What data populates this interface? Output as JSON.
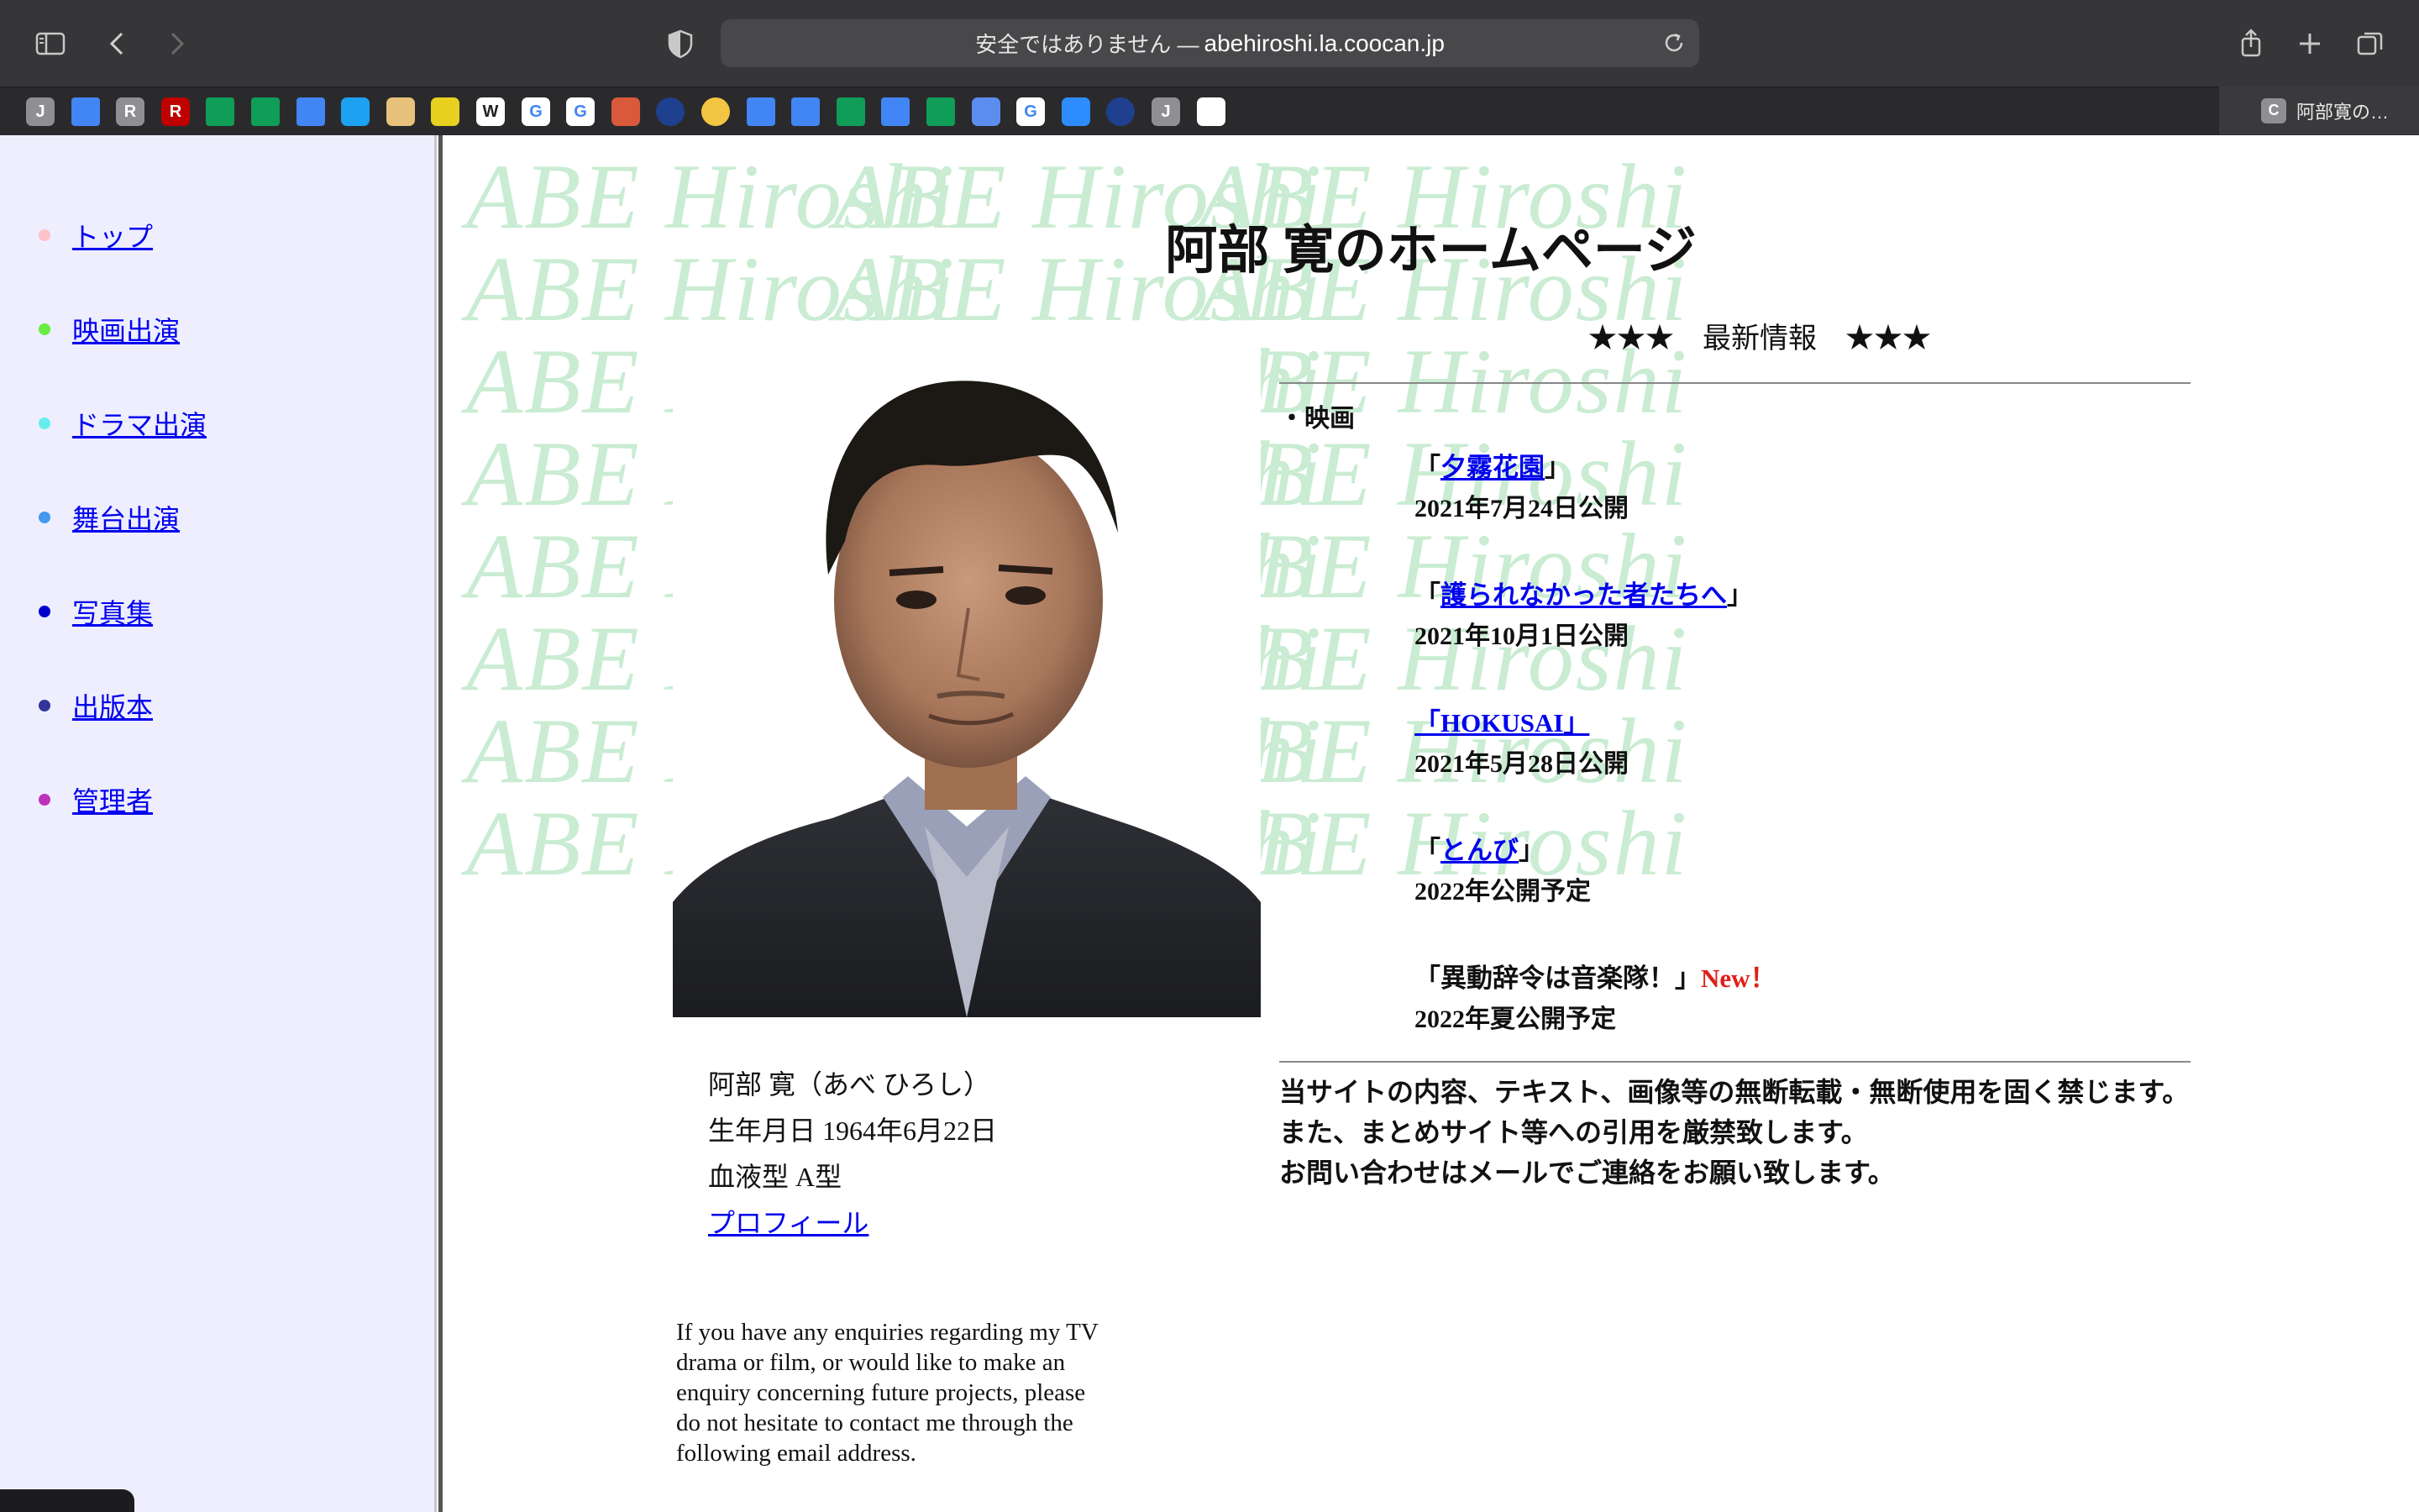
{
  "browser": {
    "address_prefix": "安全ではありません — ",
    "address_domain": "abehiroshi.la.coocan.jp",
    "favicons": [
      {
        "name": "j-icon",
        "label": "J",
        "color": "#8e8e93"
      },
      {
        "name": "google-docs-icon",
        "label": "",
        "color": "#4285f4"
      },
      {
        "name": "r-icon",
        "label": "R",
        "color": "#8e8e93"
      },
      {
        "name": "rakuten-icon",
        "label": "R",
        "color": "#bf0000"
      },
      {
        "name": "google-sheets-icon",
        "label": "",
        "color": "#0f9d58"
      },
      {
        "name": "google-sheets-icon",
        "label": "",
        "color": "#0f9d58"
      },
      {
        "name": "google-docs-icon",
        "label": "",
        "color": "#4285f4"
      },
      {
        "name": "twitter-icon",
        "label": "",
        "color": "#1da1f2"
      },
      {
        "name": "package-icon",
        "label": "",
        "color": "#e8c27a"
      },
      {
        "name": "note-icon",
        "label": "",
        "color": "#e8d020"
      },
      {
        "name": "wikipedia-icon",
        "label": "W",
        "color": "#ffffff"
      },
      {
        "name": "google-icon",
        "label": "G",
        "color": "#ffffff"
      },
      {
        "name": "google-icon",
        "label": "G",
        "color": "#ffffff"
      },
      {
        "name": "app-icon",
        "label": "",
        "color": "#d85a3a"
      },
      {
        "name": "globe-icon",
        "label": "",
        "color": "#1f3f8f"
      },
      {
        "name": "circle-icon",
        "label": "",
        "color": "#f4c542"
      },
      {
        "name": "google-docs-icon",
        "label": "",
        "color": "#4285f4"
      },
      {
        "name": "google-docs-icon",
        "label": "",
        "color": "#4285f4"
      },
      {
        "name": "google-sheets-icon",
        "label": "",
        "color": "#0f9d58"
      },
      {
        "name": "google-docs-icon",
        "label": "",
        "color": "#4285f4"
      },
      {
        "name": "google-sheets-icon",
        "label": "",
        "color": "#0f9d58"
      },
      {
        "name": "calendar-icon",
        "label": "",
        "color": "#5b8def"
      },
      {
        "name": "google-icon",
        "label": "G",
        "color": "#ffffff"
      },
      {
        "name": "zoom-icon",
        "label": "",
        "color": "#2d8cff"
      },
      {
        "name": "globe-icon",
        "label": "",
        "color": "#1f3f8f"
      },
      {
        "name": "j-icon",
        "label": "J",
        "color": "#8e8e93"
      },
      {
        "name": "github-icon",
        "label": "",
        "color": "#ffffff"
      }
    ],
    "active_tab": {
      "icon": "C",
      "title": "阿部寛の…"
    }
  },
  "sidebar": {
    "items": [
      {
        "label": "トップ",
        "dot": "#ffc0c8"
      },
      {
        "label": "映画出演",
        "dot": "#66ee44"
      },
      {
        "label": "ドラマ出演",
        "dot": "#66eeee"
      },
      {
        "label": "舞台出演",
        "dot": "#4499ee"
      },
      {
        "label": "写真集",
        "dot": "#0000cc"
      },
      {
        "label": "出版本",
        "dot": "#333399"
      },
      {
        "label": "管理者",
        "dot": "#bb33bb"
      }
    ]
  },
  "main": {
    "watermark": "ABE Hiroshi",
    "title": "阿部 寛のホームページ",
    "profile": {
      "name": "阿部 寛（あべ ひろし）",
      "birth": "生年月日 1964年6月22日",
      "blood": "血液型 A型",
      "profile_link": "プロフィール"
    },
    "enquiry": "If you have any enquiries regarding my TV drama or film, or would like to make an enquiry concerning future projects, please do not hesitate to contact me through the following email address.",
    "news": {
      "heading": "★★★　最新情報　★★★",
      "category": "・映画",
      "films": [
        {
          "title": "夕霧花園",
          "date": "2021年7月24日公開",
          "link": true,
          "new": ""
        },
        {
          "title": "護られなかった者たちへ",
          "date": "2021年10月1日公開",
          "link": true,
          "new": ""
        },
        {
          "title": "HOKUSAI",
          "date": "2021年5月28日公開",
          "link": true,
          "new": ""
        },
        {
          "title": "とんび",
          "date": "2022年公開予定",
          "link": true,
          "new": ""
        },
        {
          "title": "異動辞令は音楽隊！",
          "date": "2022年夏公開予定",
          "link": false,
          "new": "New！"
        }
      ],
      "open_bracket": "「",
      "close_bracket": "」"
    },
    "notice": [
      "当サイトの内容、テキスト、画像等の無断転載・無断使用を固く禁じます。",
      "また、まとめサイト等への引用を厳禁致します。",
      "お問い合わせはメールでご連絡をお願い致します。"
    ]
  }
}
